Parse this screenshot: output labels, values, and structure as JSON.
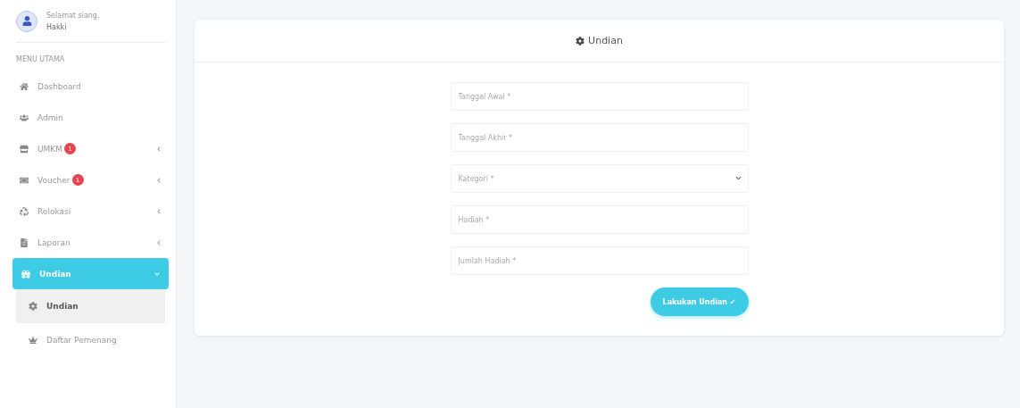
{
  "user": {
    "greeting": "Selamat siang,",
    "name": "Hakki"
  },
  "sidebar": {
    "section": "MENU UTAMA",
    "items": [
      {
        "kind": "home",
        "label": "Dashboard",
        "selected": false
      },
      {
        "kind": "users",
        "label": "Admin",
        "selected": false
      },
      {
        "kind": "store",
        "label": "UMKM",
        "badge": "1",
        "expandable": true,
        "selected": false
      },
      {
        "kind": "ticket",
        "label": "Voucher",
        "badge": "1",
        "expandable": true,
        "selected": false
      },
      {
        "kind": "recycle",
        "label": "Relokasi",
        "expandable": true,
        "selected": false
      },
      {
        "kind": "file",
        "label": "Laporan",
        "expandable": true,
        "selected": false
      },
      {
        "kind": "gift",
        "label": "Undian",
        "expandable": true,
        "selected": true,
        "expanded": true,
        "children": [
          {
            "kind": "gear",
            "label": "Undian",
            "selected": true
          },
          {
            "kind": "crown",
            "label": "Daftar Pemenang",
            "selected": false
          }
        ]
      }
    ]
  },
  "card": {
    "title": "Undian",
    "fields": [
      {
        "kind": "input",
        "placeholder": "Tanggal Awal *"
      },
      {
        "kind": "input",
        "placeholder": "Tanggal Akhir *"
      },
      {
        "kind": "select",
        "placeholder": "Kategori *"
      },
      {
        "kind": "input",
        "placeholder": "Hadiah *"
      },
      {
        "kind": "input",
        "placeholder": "Jumlah Hadiah *"
      }
    ],
    "submit": "Lakukan Undian ✔"
  }
}
